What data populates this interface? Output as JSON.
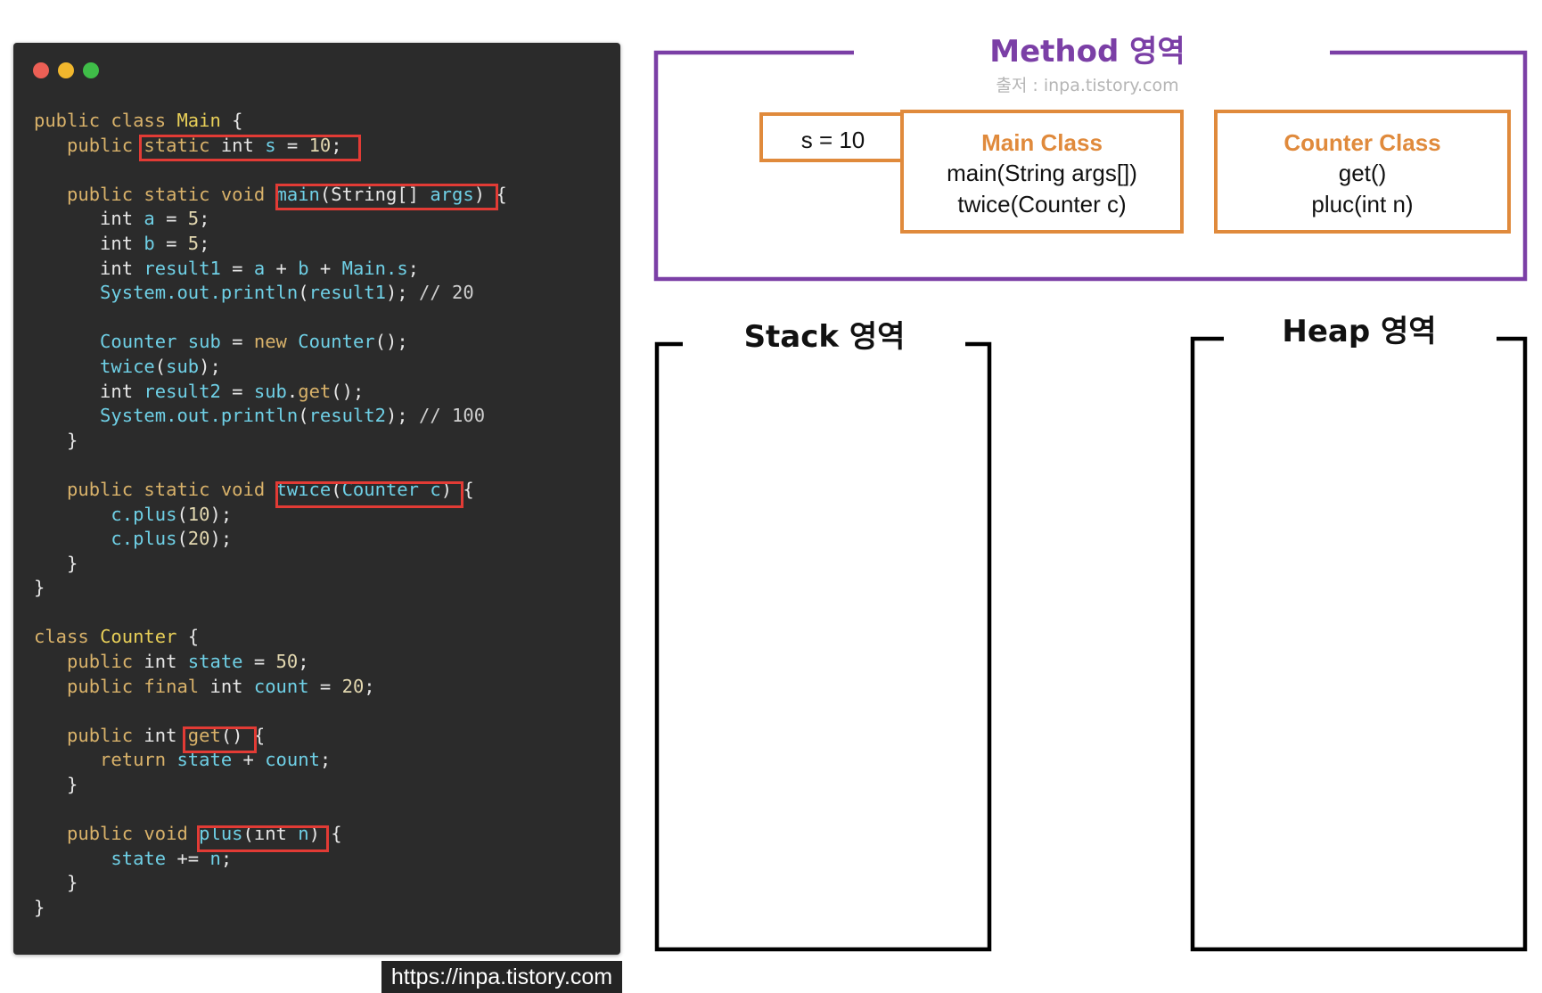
{
  "code_window": {
    "dots": [
      "red",
      "yellow",
      "green"
    ],
    "lines": [
      [
        [
          "kw",
          "public class "
        ],
        [
          "cls",
          "Main"
        ],
        [
          "plain",
          " {"
        ]
      ],
      [
        [
          "kw",
          "   public "
        ],
        [
          "kw",
          "static "
        ],
        [
          "plain",
          "int "
        ],
        [
          "id",
          "s "
        ],
        [
          "plain",
          "= "
        ],
        [
          "num",
          "10"
        ],
        [
          "plain",
          ";"
        ]
      ],
      [],
      [
        [
          "kw",
          "   public static void "
        ],
        [
          "id",
          "main"
        ],
        [
          "plain",
          "(String[] "
        ],
        [
          "id",
          "args"
        ],
        [
          "plain",
          ") {"
        ]
      ],
      [
        [
          "plain",
          "      int "
        ],
        [
          "id",
          "a "
        ],
        [
          "plain",
          "= "
        ],
        [
          "num",
          "5"
        ],
        [
          "plain",
          ";"
        ]
      ],
      [
        [
          "plain",
          "      int "
        ],
        [
          "id",
          "b "
        ],
        [
          "plain",
          "= "
        ],
        [
          "num",
          "5"
        ],
        [
          "plain",
          ";"
        ]
      ],
      [
        [
          "plain",
          "      int "
        ],
        [
          "id",
          "result1 "
        ],
        [
          "plain",
          "= "
        ],
        [
          "id",
          "a "
        ],
        [
          "plain",
          "+ "
        ],
        [
          "id",
          "b "
        ],
        [
          "plain",
          "+ "
        ],
        [
          "id",
          "Main.s"
        ],
        [
          "plain",
          ";"
        ]
      ],
      [
        [
          "id",
          "      System.out.println"
        ],
        [
          "plain",
          "("
        ],
        [
          "id",
          "result1"
        ],
        [
          "plain",
          "); "
        ],
        [
          "cmt",
          "// 20"
        ]
      ],
      [],
      [
        [
          "id",
          "      Counter sub "
        ],
        [
          "plain",
          "= "
        ],
        [
          "kw",
          "new "
        ],
        [
          "id",
          "Counter"
        ],
        [
          "plain",
          "();"
        ]
      ],
      [
        [
          "id",
          "      twice"
        ],
        [
          "plain",
          "("
        ],
        [
          "id",
          "sub"
        ],
        [
          "plain",
          ");"
        ]
      ],
      [
        [
          "plain",
          "      int "
        ],
        [
          "id",
          "result2 "
        ],
        [
          "plain",
          "= "
        ],
        [
          "id",
          "sub"
        ],
        [
          "plain",
          "."
        ],
        [
          "kw",
          "get"
        ],
        [
          "plain",
          "();"
        ]
      ],
      [
        [
          "id",
          "      System.out.println"
        ],
        [
          "plain",
          "("
        ],
        [
          "id",
          "result2"
        ],
        [
          "plain",
          "); "
        ],
        [
          "cmt",
          "// 100"
        ]
      ],
      [
        [
          "plain",
          "   }"
        ]
      ],
      [],
      [
        [
          "kw",
          "   public static void "
        ],
        [
          "id",
          "twice"
        ],
        [
          "plain",
          "("
        ],
        [
          "id",
          "Counter c"
        ],
        [
          "plain",
          ") {"
        ]
      ],
      [
        [
          "id",
          "       c.plus"
        ],
        [
          "plain",
          "("
        ],
        [
          "num",
          "10"
        ],
        [
          "plain",
          ");"
        ]
      ],
      [
        [
          "id",
          "       c.plus"
        ],
        [
          "plain",
          "("
        ],
        [
          "num",
          "20"
        ],
        [
          "plain",
          ");"
        ]
      ],
      [
        [
          "plain",
          "   }"
        ]
      ],
      [
        [
          "plain",
          "}"
        ]
      ],
      [],
      [
        [
          "kw",
          "class "
        ],
        [
          "cls",
          "Counter"
        ],
        [
          "plain",
          " {"
        ]
      ],
      [
        [
          "kw",
          "   public "
        ],
        [
          "plain",
          "int "
        ],
        [
          "id",
          "state "
        ],
        [
          "plain",
          "= "
        ],
        [
          "num",
          "50"
        ],
        [
          "plain",
          ";"
        ]
      ],
      [
        [
          "kw",
          "   public final "
        ],
        [
          "plain",
          "int "
        ],
        [
          "id",
          "count "
        ],
        [
          "plain",
          "= "
        ],
        [
          "num",
          "20"
        ],
        [
          "plain",
          ";"
        ]
      ],
      [],
      [
        [
          "kw",
          "   public "
        ],
        [
          "plain",
          "int "
        ],
        [
          "kw",
          "get"
        ],
        [
          "plain",
          "() {"
        ]
      ],
      [
        [
          "kw",
          "      return "
        ],
        [
          "id",
          "state "
        ],
        [
          "plain",
          "+ "
        ],
        [
          "id",
          "count"
        ],
        [
          "plain",
          ";"
        ]
      ],
      [
        [
          "plain",
          "   }"
        ]
      ],
      [],
      [
        [
          "kw",
          "   public void "
        ],
        [
          "id",
          "plus"
        ],
        [
          "plain",
          "(int "
        ],
        [
          "id",
          "n"
        ],
        [
          "plain",
          ") {"
        ]
      ],
      [
        [
          "id",
          "       state "
        ],
        [
          "plain",
          "+= "
        ],
        [
          "id",
          "n"
        ],
        [
          "plain",
          ";"
        ]
      ],
      [
        [
          "plain",
          "   }"
        ]
      ],
      [
        [
          "plain",
          "}"
        ]
      ]
    ],
    "watermark": "https://inpa.tistory.com"
  },
  "method_area": {
    "title": "Method 영역",
    "source": "출저 : inpa.tistory.com",
    "static_var": "s = 10",
    "main_class": {
      "title": "Main Class",
      "methods": [
        "main(String args[])",
        "twice(Counter c)"
      ]
    },
    "counter_class": {
      "title": "Counter Class",
      "methods": [
        "get()",
        "pluc(int n)"
      ]
    }
  },
  "stack_area": {
    "title": "Stack 영역"
  },
  "heap_area": {
    "title": "Heap 영역"
  },
  "colors": {
    "method_border": "#7b3fa6",
    "class_border": "#e08a3c",
    "highlight_box": "#e23b35",
    "code_bg": "#2b2b2b"
  }
}
